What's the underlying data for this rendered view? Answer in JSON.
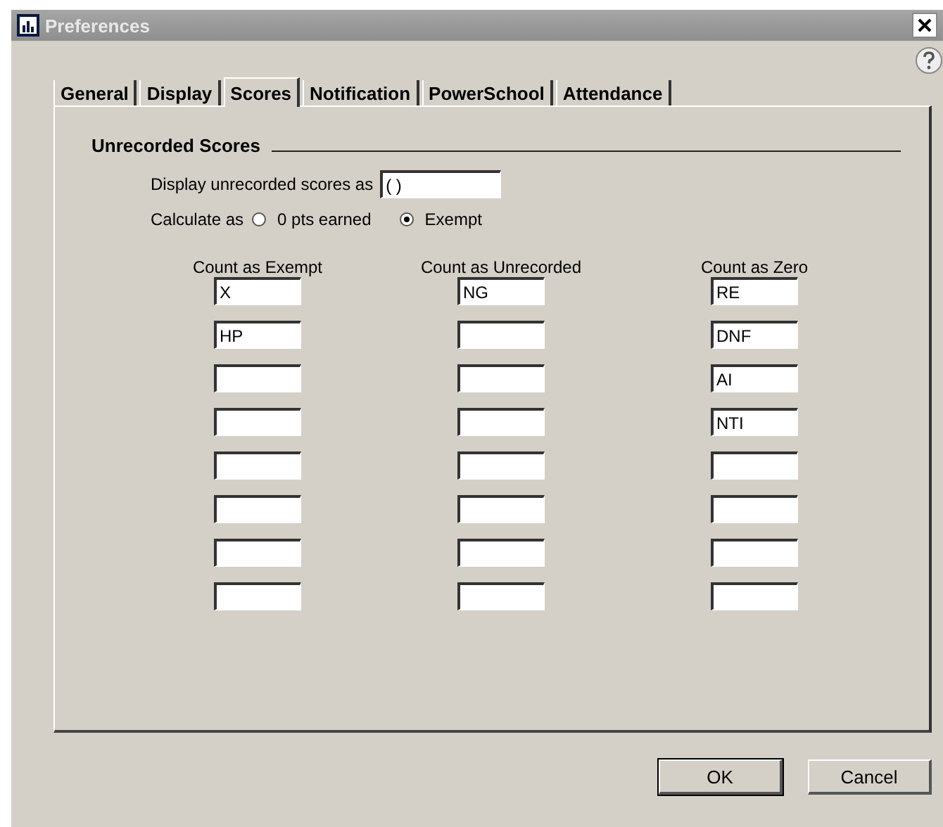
{
  "window": {
    "title": "Preferences"
  },
  "tabs": [
    {
      "label": "General",
      "selected": false
    },
    {
      "label": "Display",
      "selected": false
    },
    {
      "label": "Scores",
      "selected": true
    },
    {
      "label": "Notification",
      "selected": false
    },
    {
      "label": "PowerSchool",
      "selected": false
    },
    {
      "label": "Attendance",
      "selected": false
    }
  ],
  "group": {
    "title": "Unrecorded Scores"
  },
  "display_field": {
    "label": "Display unrecorded scores as",
    "value": "( )"
  },
  "calculate": {
    "label": "Calculate as",
    "options": [
      {
        "label": "0 pts earned",
        "selected": false
      },
      {
        "label": "Exempt",
        "selected": true
      }
    ]
  },
  "columns": [
    {
      "heading": "Count as Exempt",
      "values": [
        "X",
        "HP"
      ]
    },
    {
      "heading": "Count as Unrecorded",
      "values": [
        "NG"
      ]
    },
    {
      "heading": "Count as Zero",
      "values": [
        "RE",
        "DNF",
        "AI",
        "NTI"
      ]
    }
  ],
  "buttons": [
    {
      "label": "OK",
      "default": true
    },
    {
      "label": "Cancel",
      "default": false
    }
  ]
}
